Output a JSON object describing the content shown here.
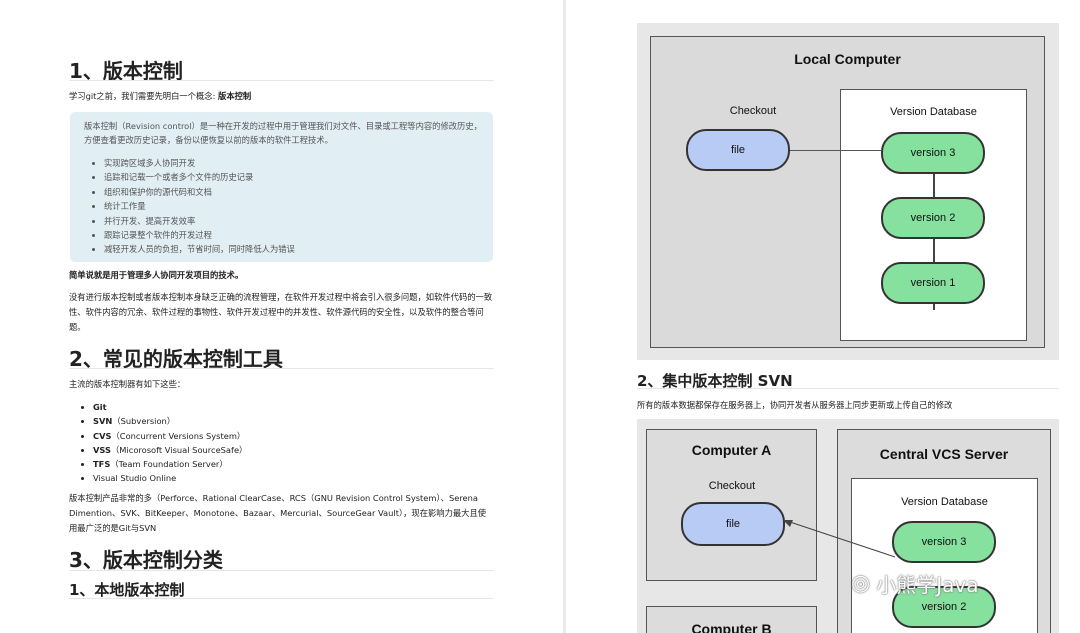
{
  "left": {
    "h1_1": "1、版本控制",
    "intro": "学习git之前，我们需要先明白一个概念: ",
    "intro_bold": "版本控制",
    "callout": {
      "text": "版本控制（Revision control）是一种在开发的过程中用于管理我们对文件、目录或工程等内容的修改历史，方便查看更改历史记录，备份以便恢复以前的版本的软件工程技术。",
      "items": [
        "实现跨区域多人协同开发",
        "追踪和记载一个或者多个文件的历史记录",
        "组织和保护你的源代码和文档",
        "统计工作量",
        "并行开发、提高开发效率",
        "跟踪记录整个软件的开发过程",
        "减轻开发人员的负担，节省时间，同时降低人为错误"
      ]
    },
    "summary": "简单说就是用于管理多人协同开发项目的技术。",
    "para2": "没有进行版本控制或者版本控制本身缺乏正确的流程管理，在软件开发过程中将会引入很多问题，如软件代码的一致性、软件内容的冗余、软件过程的事物性、软件开发过程中的并发性、软件源代码的安全性，以及软件的整合等问题。",
    "h1_2": "2、常见的版本控制工具",
    "tools_intro": "主流的版本控制器有如下这些：",
    "tools": [
      {
        "name": "Git",
        "desc": ""
      },
      {
        "name": "SVN",
        "desc": "（Subversion）"
      },
      {
        "name": "CVS",
        "desc": "（Concurrent Versions System）"
      },
      {
        "name": "VSS",
        "desc": "（Micorosoft Visual SourceSafe）"
      },
      {
        "name": "TFS",
        "desc": "（Team Foundation Server）"
      },
      {
        "name": "",
        "desc": "Visual Studio Online"
      }
    ],
    "products": "版本控制产品非常的多（Perforce、Rational ClearCase、RCS（GNU Revision Control System）、Serena Dimention、SVK、BitKeeper、Monotone、Bazaar、Mercurial、SourceGear Vault），现在影响力最大且使用最广泛的是Git与SVN",
    "h1_3": "3、版本控制分类",
    "h2_1": "1、本地版本控制"
  },
  "right": {
    "fig1": {
      "title": "Local Computer",
      "checkout": "Checkout",
      "file": "file",
      "db": "Version Database",
      "versions": [
        "version 3",
        "version 2",
        "version 1"
      ]
    },
    "h2": "2、集中版本控制 SVN",
    "desc": "所有的版本数据都保存在服务器上，协同开发者从服务器上同步更新或上传自己的修改",
    "fig2": {
      "computer_a": "Computer A",
      "checkout": "Checkout",
      "file": "file",
      "server": "Central VCS Server",
      "db": "Version Database",
      "versions": [
        "version 3",
        "version 2"
      ],
      "computer_b": "Computer B"
    }
  },
  "watermark": "小熊学Java",
  "colors": {
    "callout_bg": "#e1eef4",
    "version_green": "#86e09e",
    "file_blue": "#b8cbf5"
  }
}
